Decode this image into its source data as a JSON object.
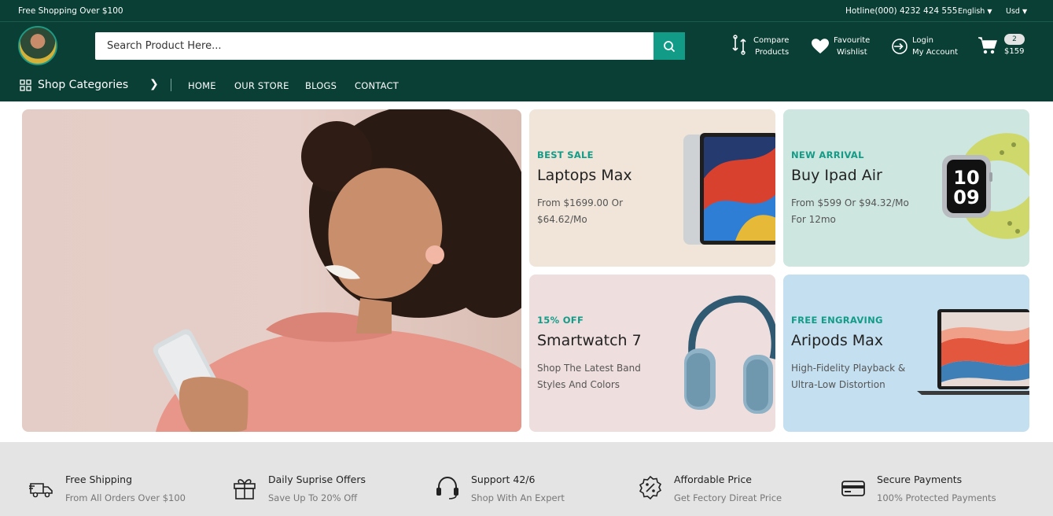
{
  "topbar": {
    "promo": "Free Shopping Over $100",
    "hotline": "Hotline(000) 4232 424 555",
    "language": "English",
    "currency": "Usd"
  },
  "header": {
    "search_placeholder": "Search Product Here...",
    "links": [
      {
        "line1": "Compare",
        "line2": "Products",
        "icon": "compare-icon"
      },
      {
        "line1": "Favourite",
        "line2": "Wishlist",
        "icon": "heart-icon"
      },
      {
        "line1": "Login",
        "line2": "My Account",
        "icon": "login-icon"
      }
    ],
    "cart": {
      "count": "2",
      "total": "$159"
    }
  },
  "nav": {
    "categories_label": "Shop Categories",
    "links": [
      "HOME",
      "OUR STORE",
      "BLOGS",
      "CONTACT"
    ]
  },
  "cards": [
    {
      "tag": "BEST SALE",
      "title": "Laptops Max",
      "desc": "From $1699.00 Or $64.62/Mo",
      "bg": "#f0e5d8"
    },
    {
      "tag": "NEW ARRIVAL",
      "title": "Buy Ipad Air",
      "desc": "From $599 Or $94.32/Mo For 12mo",
      "bg": "#cde6df"
    },
    {
      "tag": "15% OFF",
      "title": "Smartwatch 7",
      "desc": "Shop The Latest Band Styles And Colors",
      "bg": "#efdede"
    },
    {
      "tag": "FREE ENGRAVING",
      "title": "Aripods Max",
      "desc": "High-Fidelity Playback & Ultra-Low Distortion",
      "bg": "#c3dff0"
    }
  ],
  "features": [
    {
      "title": "Free Shipping",
      "subtitle": "From All Orders Over $100",
      "icon": "truck-icon"
    },
    {
      "title": "Daily Suprise Offers",
      "subtitle": "Save Up To 20% Off",
      "icon": "gift-icon"
    },
    {
      "title": "Support 42/6",
      "subtitle": "Shop With An Expert",
      "icon": "headset-icon"
    },
    {
      "title": "Affordable Price",
      "subtitle": "Get Fectory Direat Price",
      "icon": "discount-badge-icon"
    },
    {
      "title": "Secure Payments",
      "subtitle": "100% Protected Payments",
      "icon": "card-icon"
    }
  ],
  "colors": {
    "brand": "#0a3f35",
    "accent": "#129c88"
  }
}
